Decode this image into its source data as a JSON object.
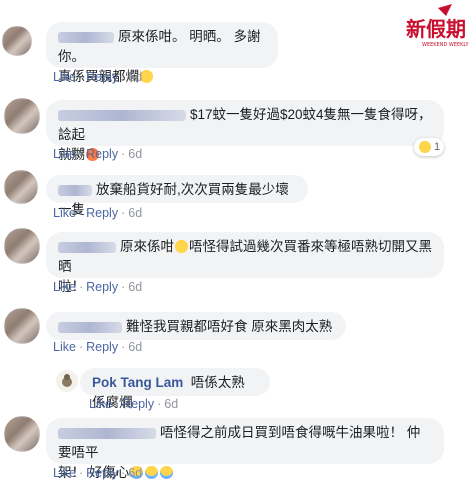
{
  "common": {
    "like": "Like",
    "reply": "Reply",
    "dot": "·",
    "age": "6d"
  },
  "logo": {
    "text": "新假期",
    "sub": "WEEKEND WEEKLY"
  },
  "comments": [
    {
      "text1": "原來係咁。 明晒。 多謝你。",
      "text2": "真係買親都爛"
    },
    {
      "text1": "$17蚊一隻好過$20蚊4隻無一隻食得呀，諗起",
      "text2": "就嬲",
      "reaction_count": "1"
    },
    {
      "text1": "放棄船貨好耐,次次買兩隻最少壞一隻"
    },
    {
      "text1": "原來係咁",
      "text1b": "唔怪得試過幾次買番來等極唔熟切開又黑晒",
      "text2": "啦！"
    },
    {
      "text1": "難怪我買親都唔好食 原來黑肉太熟"
    },
    {
      "author": "Pok Tang Lam",
      "text1": "唔係太熟 係腐爛"
    },
    {
      "text1": "唔怪得之前成日買到唔食得嘅牛油果啦！ 仲要唔平",
      "text2": "架！ 好傷心"
    }
  ]
}
